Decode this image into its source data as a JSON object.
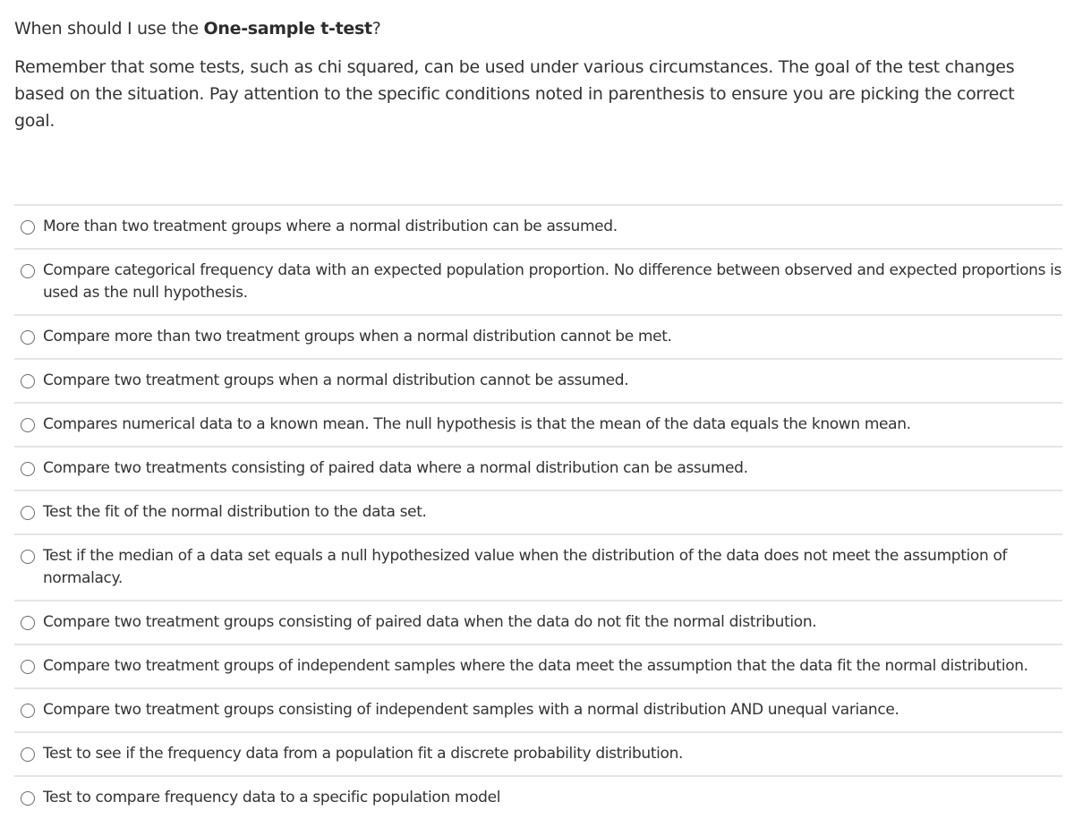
{
  "question": {
    "prompt_prefix": "When should I use the ",
    "prompt_bold": "One-sample t-test",
    "prompt_suffix": "?",
    "instructions": "Remember that some tests, such as chi squared, can be used under various circumstances. The goal of the test changes based on the situation. Pay attention to the specific conditions noted in parenthesis to ensure you are picking the correct goal."
  },
  "options": [
    {
      "label": "More than two treatment groups where a normal distribution can be assumed.",
      "selected": false
    },
    {
      "label": "Compare categorical frequency data with an expected population proportion. No difference between observed and expected proportions is used as the null hypothesis.",
      "selected": false
    },
    {
      "label": "Compare more than two treatment groups when a normal distribution cannot be met.",
      "selected": false
    },
    {
      "label": "Compare two treatment groups when a normal distribution cannot be assumed.",
      "selected": false
    },
    {
      "label": "Compares numerical data to a known mean. The null hypothesis is that the mean of the data equals the known mean.",
      "selected": false
    },
    {
      "label": "Compare two treatments consisting of paired data where a normal distribution can be assumed.",
      "selected": false
    },
    {
      "label": "Test the fit of the normal distribution to the data set.",
      "selected": false
    },
    {
      "label": "Test if the median of a data set equals a null hypothesized value when the distribution of the data does not meet the assumption of normalacy.",
      "selected": false
    },
    {
      "label": "Compare two treatment groups consisting of paired data when the data do not fit the normal distribution.",
      "selected": false
    },
    {
      "label": "Compare two treatment groups of independent samples where the data meet the assumption that the data fit the normal distribution.",
      "selected": false
    },
    {
      "label": "Compare two treatment groups consisting of independent samples with a normal distribution AND unequal variance.",
      "selected": false
    },
    {
      "label": "Test to see if the frequency data from a population fit a discrete probability distribution.",
      "selected": false
    },
    {
      "label": "Test to compare frequency data to a specific population model",
      "selected": false
    }
  ]
}
